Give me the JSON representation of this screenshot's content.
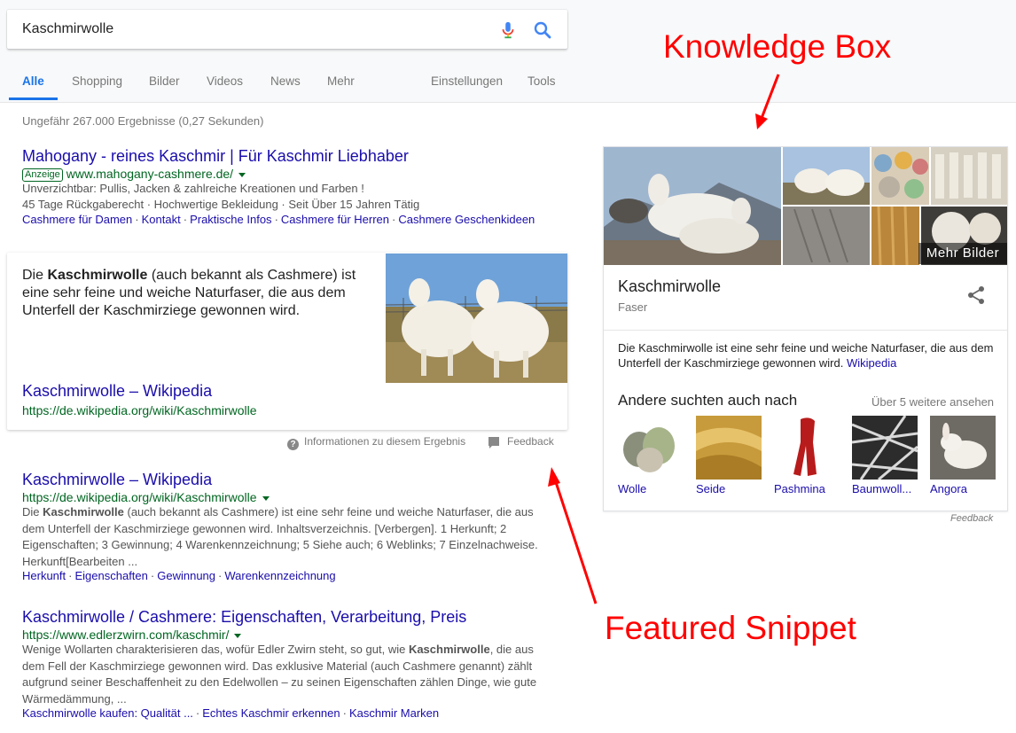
{
  "search": {
    "query": "Kaschmirwolle"
  },
  "tabs": {
    "all": "Alle",
    "shopping": "Shopping",
    "images": "Bilder",
    "videos": "Videos",
    "news": "News",
    "more": "Mehr",
    "settings": "Einstellungen",
    "tools": "Tools"
  },
  "result_stats": "Ungefähr 267.000 Ergebnisse (0,27 Sekunden)",
  "ad": {
    "title": "Mahogany - reines Kaschmir | Für Kaschmir Liebhaber",
    "badge": "Anzeige",
    "url": "www.mahogany-cashmere.de/",
    "line1": "Unverzichtbar: Pullis, Jacken & zahlreiche Kreationen und Farben !",
    "line2": "45 Tage Rückgaberecht · Hochwertige Bekleidung · Seit Über 15 Jahren Tätig",
    "sitelinks": [
      "Cashmere für Damen",
      "Kontakt",
      "Praktische Infos",
      "Cashmere für Herren",
      "Cashmere Geschenkideen"
    ]
  },
  "featured_snippet": {
    "text_before": "Die ",
    "text_bold": "Kaschmirwolle",
    "text_after": " (auch bekannt als Cashmere) ist eine sehr feine und weiche Naturfaser, die aus dem Unterfell der Kaschmirziege gewonnen wird.",
    "title": "Kaschmirwolle – Wikipedia",
    "url": "https://de.wikipedia.org/wiki/Kaschmirwolle",
    "about": "Informationen zu diesem Ergebnis",
    "feedback": "Feedback"
  },
  "results": [
    {
      "title": "Kaschmirwolle – Wikipedia",
      "url": "https://de.wikipedia.org/wiki/Kaschmirwolle",
      "s1": "Die ",
      "s_bold": "Kaschmirwolle",
      "s2": " (auch bekannt als Cashmere) ist eine sehr feine und weiche Naturfaser, die aus dem Unterfell der Kaschmirziege gewonnen wird. Inhaltsverzeichnis. [Verbergen]. 1 Herkunft; 2 Eigenschaften; 3 Gewinnung; 4 Warenkennzeichnung; 5 Siehe auch; 6 Weblinks; 7 Einzelnachweise. Herkunft[Bearbeiten ...",
      "links": [
        "Herkunft",
        "Eigenschaften",
        "Gewinnung",
        "Warenkennzeichnung"
      ]
    },
    {
      "title": "Kaschmirwolle / Cashmere: Eigenschaften, Verarbeitung, Preis",
      "url": "https://www.edlerzwirn.com/kaschmir/",
      "s1": "Wenige Wollarten charakterisieren das, wofür Edler Zwirn steht, so gut, wie ",
      "s_bold": "Kaschmirwolle",
      "s2": ", die aus dem Fell der Kaschmirziege gewonnen wird. Das exklusive Material (auch Cashmere genannt) zählt aufgrund seiner Beschaffenheit zu den Edelwollen – zu seinen Eigenschaften zählen Dinge, wie gute Wärmedämmung, ...",
      "links": [
        "Kaschmirwolle kaufen: Qualität ...",
        "Echtes Kaschmir erkennen",
        "Kaschmir Marken"
      ]
    }
  ],
  "knowledge_panel": {
    "more_images": "Mehr Bilder",
    "title": "Kaschmirwolle",
    "subtitle": "Faser",
    "description": "Die Kaschmirwolle ist eine sehr feine und weiche Naturfaser, die aus dem Unterfell der Kaschmirziege gewonnen wird.",
    "source": "Wikipedia",
    "also_searched": "Andere suchten auch nach",
    "see_more": "Über 5 weitere ansehen",
    "related": [
      "Wolle",
      "Seide",
      "Pashmina",
      "Baumwoll...",
      "Angora"
    ],
    "feedback": "Feedback"
  },
  "annotations": {
    "knowledge_box": "Knowledge Box",
    "featured_snippet": "Featured Snippet"
  },
  "colors": {
    "link": "#1a0dab",
    "url": "#006621",
    "accent": "#1a73e8",
    "annotation": "#ff0000"
  }
}
